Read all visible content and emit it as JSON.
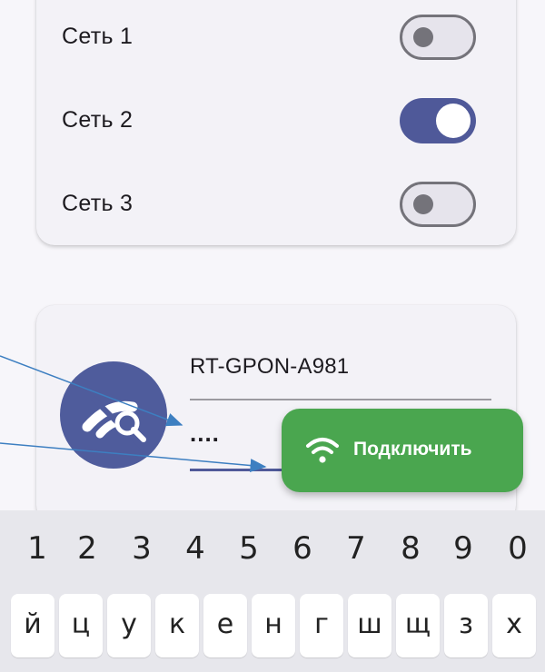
{
  "networks": [
    {
      "label": "Сеть 1",
      "enabled": false
    },
    {
      "label": "Сеть 2",
      "enabled": true
    },
    {
      "label": "Сеть 3",
      "enabled": false
    }
  ],
  "connection": {
    "ssid": "RT-GPON-A981",
    "password_masked": "....",
    "avatar_icon": "wifi-off-search-icon",
    "connect_label": "Подключить",
    "connect_icon": "wifi-icon"
  },
  "keyboard": {
    "digits": [
      "1",
      "2",
      "3",
      "4",
      "5",
      "6",
      "7",
      "8",
      "9",
      "0"
    ],
    "letters": [
      "й",
      "ц",
      "у",
      "к",
      "е",
      "н",
      "г",
      "ш",
      "щ",
      "з",
      "х"
    ]
  },
  "colors": {
    "accent": "#4f5999",
    "avatar": "#4f5c9c",
    "connect_button": "#4aa64f",
    "annotation_arrow": "#3d7fc1"
  }
}
